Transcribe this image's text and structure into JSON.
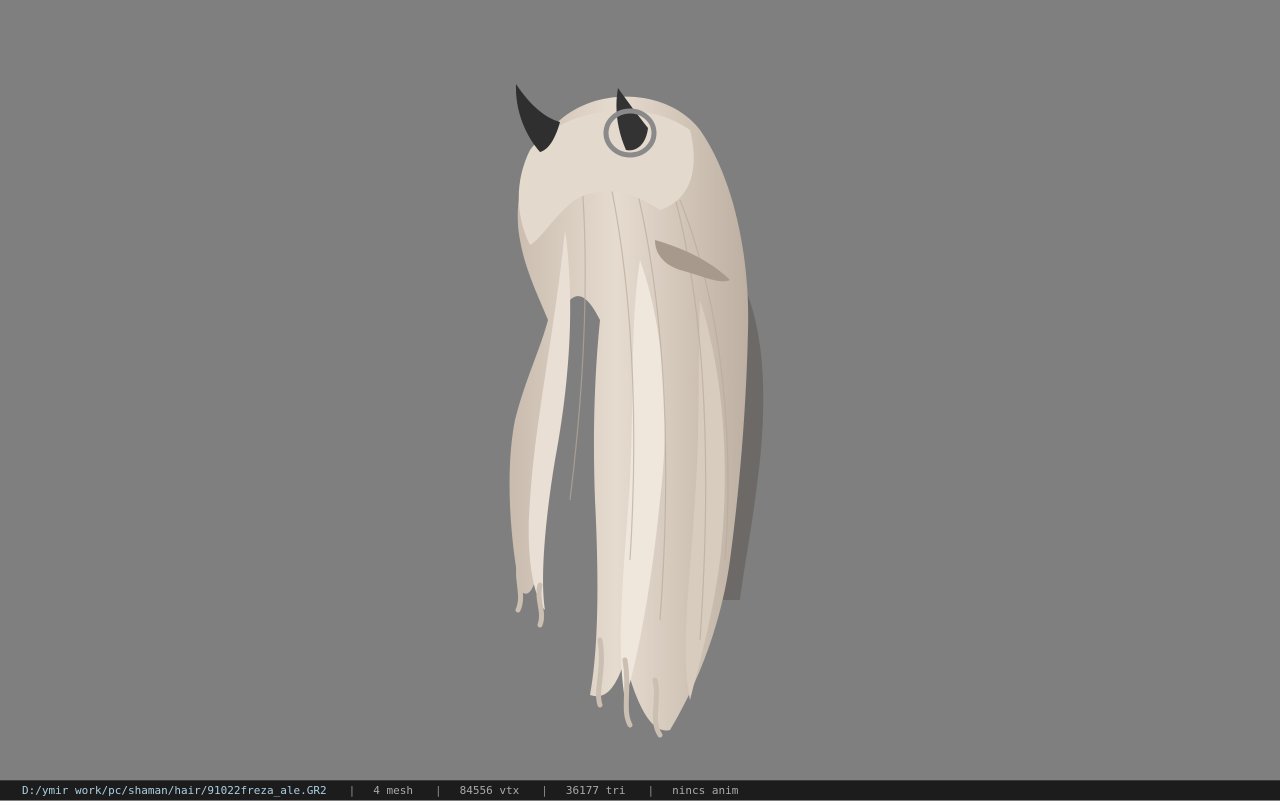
{
  "viewport": {
    "background": "#7f7f7f",
    "model": {
      "hair_color": "#e0d4c7",
      "horn_color": "#2f2f2f",
      "ring_color": "#8a8a8a"
    }
  },
  "statusbar": {
    "file_path": "D:/ymir work/pc/shaman/hair/91022freza_ale.GR2",
    "separator": "|",
    "mesh_count": "4 mesh",
    "vertex_count": "84556 vtx",
    "triangle_count": "36177 tri",
    "anim_status": "nincs anim"
  }
}
